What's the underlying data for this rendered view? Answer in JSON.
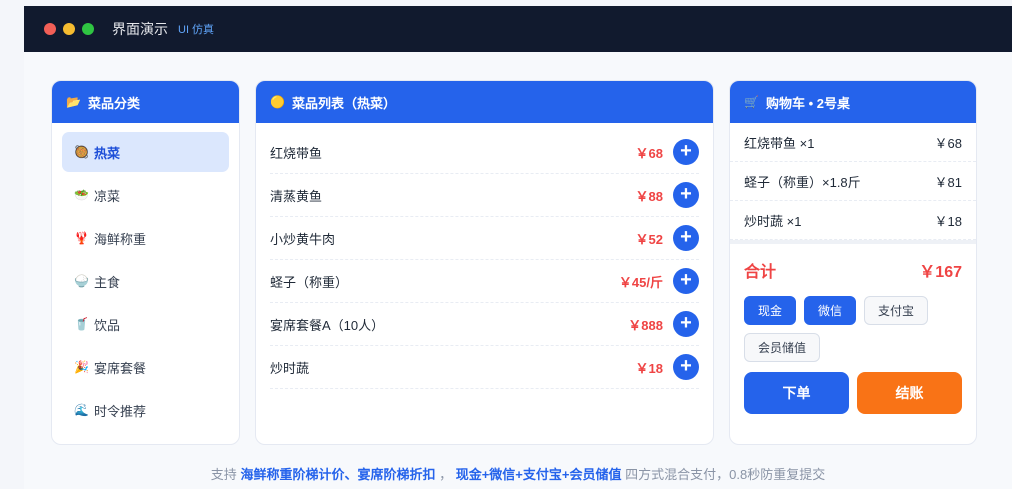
{
  "window": {
    "title": "界面演示",
    "subtitle": "UI 仿真"
  },
  "categories": {
    "header": "菜品分类",
    "header_icon": "📂",
    "items": [
      {
        "label": "热菜",
        "icon": "🥘",
        "active": true
      },
      {
        "label": "凉菜",
        "icon": "🥗",
        "active": false
      },
      {
        "label": "海鲜称重",
        "icon": "🦞",
        "active": false
      },
      {
        "label": "主食",
        "icon": "🍚",
        "active": false
      },
      {
        "label": "饮品",
        "icon": "🥤",
        "active": false
      },
      {
        "label": "宴席套餐",
        "icon": "🎉",
        "active": false
      },
      {
        "label": "时令推荐",
        "icon": "🌊",
        "active": false
      }
    ]
  },
  "dishes": {
    "header": "菜品列表（热菜）",
    "header_icon": "🟡",
    "add_symbol": "+",
    "items": [
      {
        "name": "红烧带鱼",
        "price": "￥68"
      },
      {
        "name": "清蒸黄鱼",
        "price": "￥88"
      },
      {
        "name": "小炒黄牛肉",
        "price": "￥52"
      },
      {
        "name": "蛏子（称重）",
        "price": "￥45/斤"
      },
      {
        "name": "宴席套餐A（10人）",
        "price": "￥888"
      },
      {
        "name": "炒时蔬",
        "price": "￥18"
      }
    ]
  },
  "cart": {
    "header": "购物车 • 2号桌",
    "header_icon": "🛒",
    "items": [
      {
        "name": "红烧带鱼 ×1",
        "amount": "￥68"
      },
      {
        "name": "蛏子（称重）×1.8斤",
        "amount": "￥81"
      },
      {
        "name": "炒时蔬 ×1",
        "amount": "￥18"
      }
    ],
    "total_label": "合计",
    "total_value": "￥167",
    "payments": [
      {
        "label": "现金",
        "selected": true
      },
      {
        "label": "微信",
        "selected": true
      },
      {
        "label": "支付宝",
        "selected": false
      },
      {
        "label": "会员储值",
        "selected": false
      }
    ],
    "order_label": "下单",
    "checkout_label": "结账"
  },
  "footer": {
    "prefix": "支持",
    "highlight1": "海鲜称重阶梯计价、宴席阶梯折扣",
    "sep": "，",
    "highlight2": "现金+微信+支付宝+会员储值",
    "suffix": "四方式混合支付，0.8秒防重复提交"
  },
  "colors": {
    "accent": "#2563eb",
    "price": "#ef4444",
    "checkout": "#f97316",
    "titlebar": "#111a2e"
  }
}
